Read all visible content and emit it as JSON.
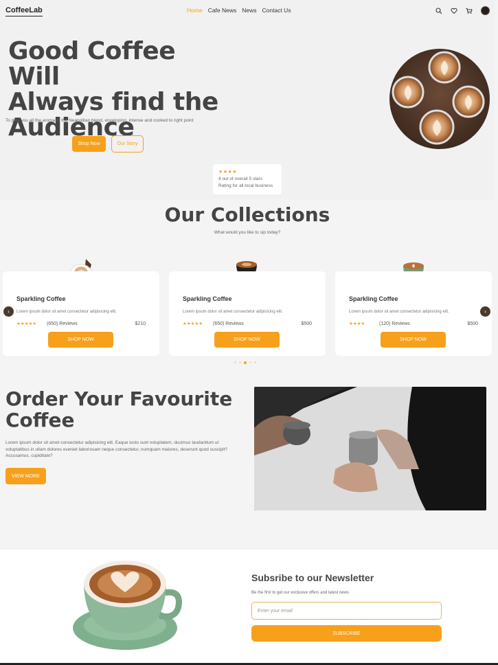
{
  "brand": {
    "logo": "CoffeeLab",
    "accent": "#f7a01b"
  },
  "nav": {
    "items": [
      "Home",
      "Cafe News",
      "News",
      "Contact Us"
    ],
    "active": 0
  },
  "header_icons": [
    "search-icon",
    "heart-icon",
    "cart-icon",
    "avatar"
  ],
  "hero": {
    "title_line1": "Good Coffee Will",
    "title_line2": "Always find the",
    "title_line3": "Audience",
    "subtitle": "To give you all the aroma of the Neapolitan blend, enveloping, intense and cooked to right point",
    "primary_button": "Shop Now",
    "secondary_button": "Our Story",
    "rating": {
      "stars": "★★★★",
      "line1": "4 out of overall 5 stars",
      "line2": "Rating for all local business"
    }
  },
  "collections": {
    "title": "Our Collections",
    "subtitle": "What would you like to sip today?",
    "cards": [
      {
        "name": "Sparkling Coffee",
        "desc": "Lorem ipsum dolor sit amet consectetur adipisicing elit.",
        "stars": "★★★★★",
        "reviews": "(650) Reviews",
        "price": "$210",
        "button": "SHOP NOW"
      },
      {
        "name": "Sparkling Coffee",
        "desc": "Lorem ipsum dolor sit amet consectetur adipisicing elit.",
        "stars": "★★★★★",
        "reviews": "(650) Reviews",
        "price": "$500",
        "button": "SHOP NOW"
      },
      {
        "name": "Sparkling Coffee",
        "desc": "Lorem ipsum dolor sit amet consectetur adipisicing elit.",
        "stars": "★★★★",
        "reviews": "(120) Reviews",
        "price": "$500",
        "button": "SHOP NOW"
      }
    ],
    "prev_arrow": "‹",
    "next_arrow": "›",
    "carousel_pages": 5,
    "carousel_active": 2
  },
  "order": {
    "title_line1": "Order Your Favourite",
    "title_line2": "Coffee",
    "desc": "Lorem ipsum dolor sit amet consectetur adipisicing elit. Eaque iusto sunt voluptatem, ducimus laudantium ut voluptatibus in ullam dolores eveniet laboriosam neque consectetur, numquam maiores, deserunt quod suscipit? Accusamus, cupiditate?",
    "button": "VIEW MORE"
  },
  "newsletter": {
    "title": "Subsribe to our Newsletter",
    "subtitle": "Be the first to get our exclusive offers and latest news",
    "placeholder": "Enter your email",
    "button": "SUBSCRIBE"
  }
}
